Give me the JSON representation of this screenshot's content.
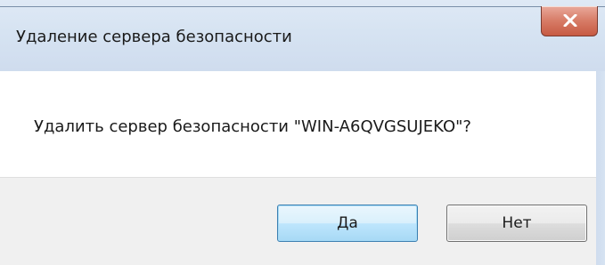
{
  "window": {
    "title": "Удаление сервера безопасности"
  },
  "dialog": {
    "message": "Удалить сервер безопасности \"WIN-A6QVGSUJEKO\"?"
  },
  "buttons": {
    "yes_label": "Да",
    "no_label": "Нет"
  },
  "icons": {
    "close": "close-icon"
  },
  "colors": {
    "titlebar": "#d6e3f2",
    "close_button": "#d77b66",
    "default_button_border": "#3c7fb1",
    "footer": "#f0f0f0"
  }
}
